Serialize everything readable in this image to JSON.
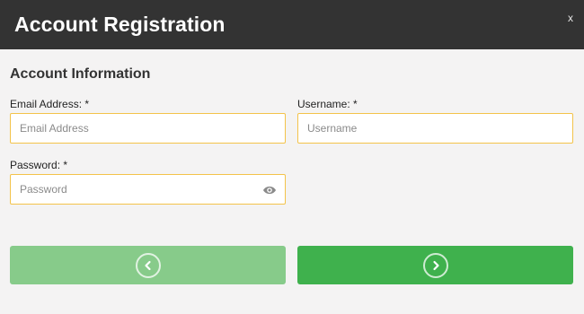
{
  "header": {
    "title": "Account Registration",
    "close_label": "x"
  },
  "section": {
    "title": "Account Information"
  },
  "fields": {
    "email": {
      "label": "Email Address: *",
      "placeholder": "Email Address",
      "value": ""
    },
    "username": {
      "label": "Username: *",
      "placeholder": "Username",
      "value": ""
    },
    "password": {
      "label": "Password: *",
      "placeholder": "Password",
      "value": ""
    }
  },
  "icons": {
    "close": "close-icon",
    "password_visibility": "eye-icon",
    "previous": "chevron-left-icon",
    "next": "chevron-right-icon"
  },
  "colors": {
    "header_bg": "#333333",
    "input_border": "#f3c34a",
    "prev_button": "#87cb8a",
    "next_button": "#3fb14d",
    "page_bg": "#f4f3f3"
  }
}
